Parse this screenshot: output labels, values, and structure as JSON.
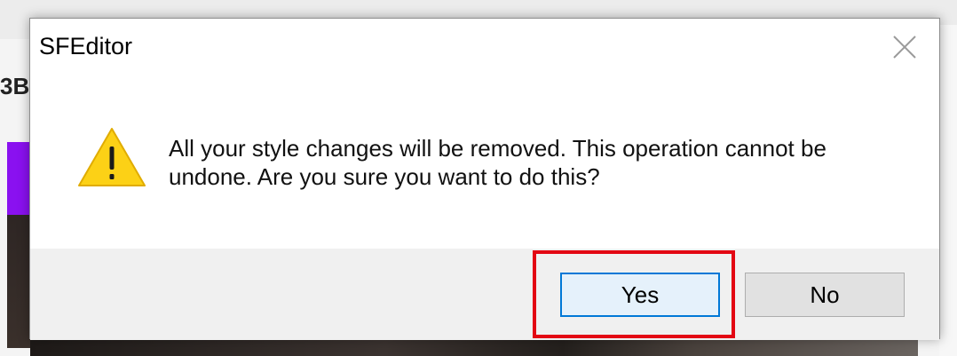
{
  "background": {
    "partial_text": "3B"
  },
  "dialog": {
    "title": "SFEditor",
    "message": "All your style changes will be removed.  This operation cannot be undone.  Are you sure you want to do this?",
    "icon": "warning-icon",
    "buttons": {
      "yes_label": "Yes",
      "no_label": "No"
    }
  },
  "colors": {
    "highlight": "#e30613",
    "focus_border": "#0078d7",
    "warning_fill": "#fcd116",
    "button_bg": "#e1e1e1",
    "footer_bg": "#f0f0f0"
  }
}
